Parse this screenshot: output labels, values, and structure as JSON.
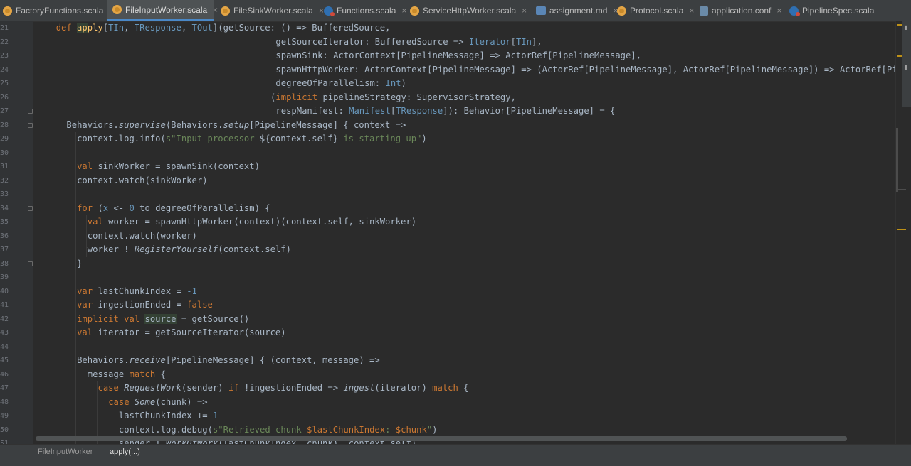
{
  "tabs": [
    {
      "label": "FactoryFunctions.scala",
      "icon": "scala-object-icon",
      "active": false
    },
    {
      "label": "FileInputWorker.scala",
      "icon": "scala-object-icon",
      "active": true
    },
    {
      "label": "FileSinkWorker.scala",
      "icon": "scala-object-icon",
      "active": false
    },
    {
      "label": "Functions.scala",
      "icon": "scala-class-icon",
      "active": false
    },
    {
      "label": "ServiceHttpWorker.scala",
      "icon": "scala-object-icon",
      "active": false
    },
    {
      "label": "assignment.md",
      "icon": "markdown-file-icon",
      "active": false
    },
    {
      "label": "Protocol.scala",
      "icon": "scala-object-icon",
      "active": false
    },
    {
      "label": "application.conf",
      "icon": "config-file-icon",
      "active": false
    },
    {
      "label": "PipelineSpec.scala",
      "icon": "scala-class-icon",
      "active": false
    }
  ],
  "close_glyph": "×",
  "line_numbers": [
    "21",
    "22",
    "23",
    "24",
    "25",
    "26",
    "27",
    "28",
    "29",
    "30",
    "31",
    "32",
    "33",
    "34",
    "35",
    "36",
    "37",
    "38",
    "39",
    "40",
    "41",
    "42",
    "43",
    "44",
    "45",
    "46",
    "47",
    "48",
    "49",
    "50",
    "51"
  ],
  "code": [
    {
      "indent": 1,
      "segs": [
        [
          "kw",
          "def "
        ],
        [
          "hl",
          "ap"
        ],
        [
          "fn",
          "ply"
        ],
        [
          "",
          "["
        ],
        [
          "tp",
          "TIn"
        ],
        [
          "",
          ", "
        ],
        [
          "tp",
          "TResponse"
        ],
        [
          "",
          ", "
        ],
        [
          "tp",
          "TOut"
        ],
        [
          "",
          "](getSource: () => BufferedSource,"
        ]
      ]
    },
    {
      "indent": 22,
      "segs": [
        [
          "",
          "getSourceIterator: BufferedSource => "
        ],
        [
          "tp",
          "Iterator"
        ],
        [
          "",
          "["
        ],
        [
          "tp",
          "TIn"
        ],
        [
          "",
          "],"
        ]
      ]
    },
    {
      "indent": 22,
      "segs": [
        [
          "",
          "spawnSink: ActorContext[PipelineMessage] => ActorRef[PipelineMessage],"
        ]
      ]
    },
    {
      "indent": 22,
      "segs": [
        [
          "",
          "spawnHttpWorker: ActorContext[PipelineMessage] => (ActorRef[PipelineMessage], ActorRef[PipelineMessage]) => ActorRef[PipelineMessa"
        ]
      ]
    },
    {
      "indent": 22,
      "segs": [
        [
          "",
          "degreeOfParallelism: "
        ],
        [
          "tp",
          "Int"
        ],
        [
          "",
          ")"
        ]
      ]
    },
    {
      "indent": 21.5,
      "segs": [
        [
          "",
          "("
        ],
        [
          "kw",
          "implicit "
        ],
        [
          "",
          "pipelineStrategy: SupervisorStrategy,"
        ]
      ]
    },
    {
      "indent": 22,
      "segs": [
        [
          "",
          "respManifest: "
        ],
        [
          "tp",
          "Manifest"
        ],
        [
          "",
          "["
        ],
        [
          "tp",
          "TResponse"
        ],
        [
          "",
          "]): Behavior[PipelineMessage] = {"
        ]
      ]
    },
    {
      "indent": 2,
      "segs": [
        [
          "",
          "Behaviors."
        ],
        [
          "it",
          "supervise"
        ],
        [
          "",
          "(Behaviors."
        ],
        [
          "it",
          "setup"
        ],
        [
          "",
          "[PipelineMessage] { context =>"
        ]
      ]
    },
    {
      "indent": 3,
      "segs": [
        [
          "",
          "context.log.info("
        ],
        [
          "str",
          "s\"Input processor "
        ],
        [
          "",
          "${context.self}"
        ],
        [
          "str",
          " is starting up\""
        ],
        [
          "",
          ")"
        ]
      ]
    },
    {
      "indent": 0,
      "segs": [
        [
          "",
          ""
        ]
      ]
    },
    {
      "indent": 3,
      "segs": [
        [
          "kw",
          "val "
        ],
        [
          "",
          "sinkWorker = spawnSink(context)"
        ]
      ]
    },
    {
      "indent": 3,
      "segs": [
        [
          "",
          "context.watch(sinkWorker)"
        ]
      ]
    },
    {
      "indent": 0,
      "segs": [
        [
          "",
          ""
        ]
      ]
    },
    {
      "indent": 3,
      "segs": [
        [
          "kw",
          "for "
        ],
        [
          "",
          "("
        ],
        [
          "tp",
          "x"
        ],
        [
          "",
          " <- "
        ],
        [
          "tp",
          "0"
        ],
        [
          "",
          " to degreeOfParallelism) {"
        ]
      ]
    },
    {
      "indent": 4,
      "segs": [
        [
          "kw",
          "val "
        ],
        [
          "",
          "worker = spawnHttpWorker(context)(context.self, sinkWorker)"
        ]
      ]
    },
    {
      "indent": 4,
      "segs": [
        [
          "",
          "context.watch(worker)"
        ]
      ]
    },
    {
      "indent": 4,
      "segs": [
        [
          "",
          "worker ! "
        ],
        [
          "it",
          "RegisterYourself"
        ],
        [
          "",
          "(context.self)"
        ]
      ]
    },
    {
      "indent": 3,
      "segs": [
        [
          "",
          "}"
        ]
      ]
    },
    {
      "indent": 0,
      "segs": [
        [
          "",
          ""
        ]
      ]
    },
    {
      "indent": 3,
      "segs": [
        [
          "kw",
          "var "
        ],
        [
          "",
          "lastChunkIndex = "
        ],
        [
          "tp",
          "-1"
        ]
      ]
    },
    {
      "indent": 3,
      "segs": [
        [
          "kw",
          "var "
        ],
        [
          "",
          "ingestionEnded = "
        ],
        [
          "kw",
          "false"
        ]
      ]
    },
    {
      "indent": 3,
      "segs": [
        [
          "kw",
          "implicit val "
        ],
        [
          "hl",
          "source"
        ],
        [
          "",
          " = getSource()"
        ]
      ]
    },
    {
      "indent": 3,
      "segs": [
        [
          "kw",
          "val "
        ],
        [
          "",
          "iterator = getSourceIterator(source)"
        ]
      ]
    },
    {
      "indent": 0,
      "segs": [
        [
          "",
          ""
        ]
      ]
    },
    {
      "indent": 3,
      "segs": [
        [
          "",
          "Behaviors."
        ],
        [
          "it",
          "receive"
        ],
        [
          "",
          "[PipelineMessage] { (context, message) =>"
        ]
      ]
    },
    {
      "indent": 4,
      "segs": [
        [
          "",
          "message "
        ],
        [
          "kw",
          "match "
        ],
        [
          "",
          "{"
        ]
      ]
    },
    {
      "indent": 5,
      "segs": [
        [
          "kw",
          "case "
        ],
        [
          "it",
          "RequestWork"
        ],
        [
          "",
          "(sender) "
        ],
        [
          "kw",
          "if "
        ],
        [
          "",
          "!ingestionEnded => "
        ],
        [
          "it",
          "ingest"
        ],
        [
          "",
          "(iterator) "
        ],
        [
          "kw",
          "match "
        ],
        [
          "",
          "{"
        ]
      ]
    },
    {
      "indent": 6,
      "segs": [
        [
          "kw",
          "case "
        ],
        [
          "it",
          "Some"
        ],
        [
          "",
          "(chunk) =>"
        ]
      ]
    },
    {
      "indent": 7,
      "segs": [
        [
          "",
          "lastChunkIndex += "
        ],
        [
          "tp",
          "1"
        ]
      ]
    },
    {
      "indent": 7,
      "segs": [
        [
          "",
          "context.log.debug("
        ],
        [
          "str",
          "s\"Retrieved chunk "
        ],
        [
          "kw",
          "$lastChunkIndex"
        ],
        [
          "str",
          ": "
        ],
        [
          "kw",
          "$chunk"
        ],
        [
          "str",
          "\""
        ],
        [
          "",
          ")"
        ]
      ]
    },
    {
      "indent": 7,
      "segs": [
        [
          "",
          "sender ! "
        ],
        [
          "it",
          "WorkOfWork"
        ],
        [
          "",
          "(lastChunkIndex, chunk), context.self)"
        ]
      ]
    }
  ],
  "breadcrumb": {
    "file": "FileInputWorker",
    "member": "apply(...)"
  },
  "colors": {
    "keyword": "#cc7832",
    "type": "#6897bb",
    "string": "#6a8759",
    "function": "#ffc66d",
    "text": "#a9b7c6",
    "background": "#2b2b2b"
  }
}
